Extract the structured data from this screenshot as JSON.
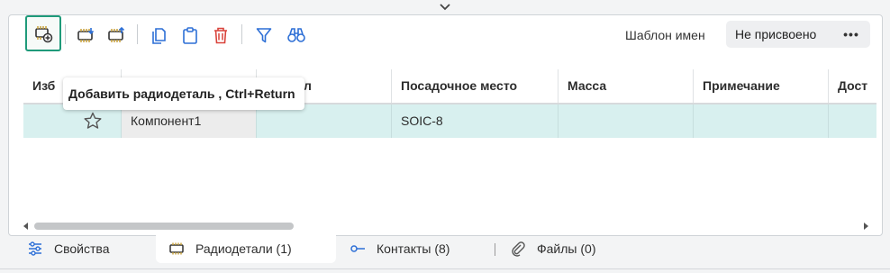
{
  "toolbar": {
    "buttons": [
      {
        "name": "add-component-button",
        "icon": "chip-add-icon"
      },
      {
        "name": "import-component-button",
        "icon": "chip-import-icon"
      },
      {
        "name": "export-component-button",
        "icon": "chip-export-icon"
      },
      {
        "name": "copy-button",
        "icon": "copy-icon"
      },
      {
        "name": "paste-button",
        "icon": "clipboard-icon"
      },
      {
        "name": "delete-button",
        "icon": "trash-icon"
      },
      {
        "name": "filter-button",
        "icon": "filter-icon"
      },
      {
        "name": "find-button",
        "icon": "binoculars-icon"
      }
    ],
    "template_label": "Шаблон имен",
    "template_value": "Не присвоено",
    "more_label": "•••"
  },
  "tooltip": "Добавить радиодеталь , Ctrl+Return",
  "table": {
    "columns": [
      "Изб",
      "",
      "л",
      "Посадочное место",
      "Масса",
      "Примечание",
      "Дост"
    ],
    "rows": [
      {
        "favorite": false,
        "name": "Компонент1",
        "col3": "",
        "footprint": "SOIC-8",
        "mass": "",
        "note": "",
        "avail": ""
      }
    ]
  },
  "tabs": [
    {
      "label": "Свойства",
      "icon": "sliders-icon",
      "active": false
    },
    {
      "label": "Радиодетали (1)",
      "icon": "chip-icon",
      "active": true
    },
    {
      "label": "Контакты (8)",
      "icon": "pin-icon",
      "active": false
    },
    {
      "label": "Файлы (0)",
      "icon": "paperclip-icon",
      "active": false
    }
  ],
  "colors": {
    "accent": "#1f9a7a",
    "icon_blue": "#2d6fd6",
    "delete_red": "#d9433b",
    "chip_gold": "#c8a13a",
    "row_selected": "#d8f0ef"
  }
}
